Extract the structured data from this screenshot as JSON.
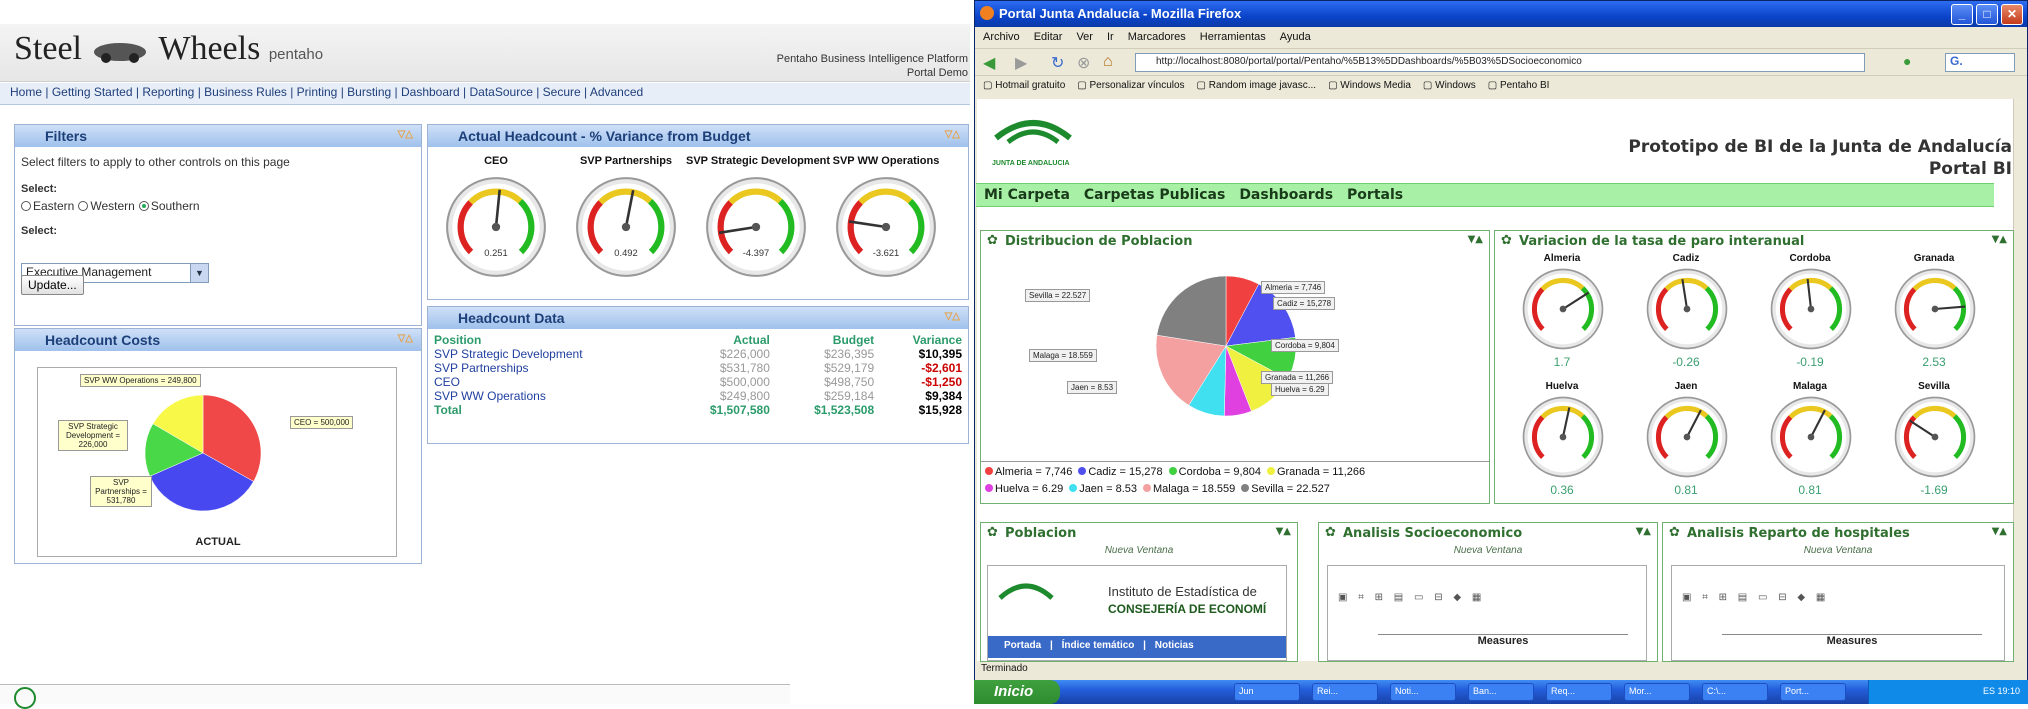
{
  "steelwheels": {
    "logo_text": "Steel",
    "logo_text2": "Wheels",
    "logo_suffix": "pentaho",
    "platform_line1": "Pentaho Business Intelligence Platform",
    "platform_line2": "Portal Demo",
    "nav": [
      "Home",
      "Getting Started",
      "Reporting",
      "Business Rules",
      "Printing",
      "Bursting",
      "Dashboard",
      "DataSource",
      "Secure",
      "Advanced"
    ],
    "filters": {
      "title": "Filters",
      "intro": "Select filters to apply to other controls on this page",
      "select_label1": "Select:",
      "radio_options": [
        "Eastern",
        "Western",
        "Southern"
      ],
      "radio_selected": "Southern",
      "select_label2": "Select:",
      "select_value": "Executive Management",
      "update_button": "Update..."
    },
    "headcount_costs": {
      "title": "Headcount Costs",
      "chart_caption": "ACTUAL",
      "labels": [
        "SVP WW Operations = 249,800",
        "SVP Strategic Development = 226,000",
        "SVP Partnerships = 531,780",
        "CEO = 500,000"
      ]
    },
    "actual_headcount": {
      "title": "Actual Headcount - % Variance from Budget",
      "gauges": [
        {
          "label": "CEO",
          "value": "0.251"
        },
        {
          "label": "SVP Partnerships",
          "value": "0.492"
        },
        {
          "label": "SVP Strategic Development",
          "value": "-4.397"
        },
        {
          "label": "SVP WW Operations",
          "value": "-3.621"
        }
      ]
    },
    "headcount_data": {
      "title": "Headcount Data",
      "headers": [
        "Position",
        "Actual",
        "Budget",
        "Variance"
      ],
      "rows": [
        [
          "SVP Strategic Development",
          "$226,000",
          "$236,395",
          "$10,395"
        ],
        [
          "SVP Partnerships",
          "$531,780",
          "$529,179",
          "-$2,601"
        ],
        [
          "CEO",
          "$500,000",
          "$498,750",
          "-$1,250"
        ],
        [
          "SVP WW Operations",
          "$249,800",
          "$259,184",
          "$9,384"
        ],
        [
          "Total",
          "$1,507,580",
          "$1,523,508",
          "$15,928"
        ]
      ]
    }
  },
  "firefox": {
    "window_title": "Portal Junta Andalucía - Mozilla Firefox",
    "menu": [
      "Archivo",
      "Editar",
      "Ver",
      "Ir",
      "Marcadores",
      "Herramientas",
      "Ayuda"
    ],
    "url": "http://localhost:8080/portal/portal/Pentaho/%5B13%5DDashboards/%5B03%5DSocioeconomico",
    "bookmarks": [
      "Hotmail gratuito",
      "Personalizar vínculos",
      "Random image javasc...",
      "Windows Media",
      "Windows",
      "Pentaho BI"
    ],
    "status": "Terminado",
    "taskbar_start": "Inicio",
    "taskbar_items": [
      "Jun",
      "Rei...",
      "Noti...",
      "Ban...",
      "Req...",
      "Mor...",
      "C:\\...",
      "Port..."
    ],
    "tray": "ES 19:10"
  },
  "portal": {
    "logo_caption": "JUNTA DE ANDALUCIA",
    "title_line1": "Prototipo de BI de la Junta de Andalucía",
    "title_line2": "Portal BI",
    "menu": [
      "Mi Carpeta",
      "Carpetas Publicas",
      "Dashboards",
      "Portals"
    ],
    "distribucion": {
      "title": "Distribucion de Poblacion",
      "legend_row1": [
        "Almeria = 7,746",
        "Cadiz = 15,278",
        "Cordoba = 9,804",
        "Granada = 11,266"
      ],
      "legend_row2": [
        "Huelva = 6.29",
        "Jaen = 8.53",
        "Malaga = 18.559",
        "Sevilla = 22.527"
      ]
    },
    "variacion": {
      "title": "Variacion de la tasa de paro interanual",
      "gauges": [
        {
          "label": "Almeria",
          "value": "1.7"
        },
        {
          "label": "Cadiz",
          "value": "-0.26"
        },
        {
          "label": "Cordoba",
          "value": "-0.19"
        },
        {
          "label": "Granada",
          "value": "2.53"
        },
        {
          "label": "Huelva",
          "value": "0.36"
        },
        {
          "label": "Jaen",
          "value": "0.81"
        },
        {
          "label": "Malaga",
          "value": "0.81"
        },
        {
          "label": "Sevilla",
          "value": "-1.69"
        }
      ]
    },
    "poblacion": {
      "title": "Poblacion",
      "subtitle": "Nueva Ventana",
      "inst_line1": "Instituto de Estadística de",
      "inst_line2": "CONSEJERÍA DE ECONOMÍ",
      "links": [
        "Portada",
        "Índice temático",
        "Noticias"
      ]
    },
    "socio": {
      "title": "Analisis Socioeconomico",
      "subtitle": "Nueva Ventana",
      "measures": "Measures"
    },
    "hospitales": {
      "title": "Analisis Reparto de hospitales",
      "subtitle": "Nueva Ventana",
      "measures": "Measures"
    }
  },
  "chart_data": [
    {
      "type": "pie",
      "title": "",
      "caption": "ACTUAL",
      "categories": [
        "CEO",
        "SVP Partnerships",
        "SVP Strategic Development",
        "SVP WW Operations"
      ],
      "values": [
        500000,
        531780,
        226000,
        249800
      ],
      "colors": [
        "#f04848",
        "#4848f0",
        "#48d848",
        "#f8f848"
      ]
    },
    {
      "type": "pie",
      "title": "Distribucion de Poblacion",
      "categories": [
        "Almeria",
        "Cadiz",
        "Cordoba",
        "Granada",
        "Huelva",
        "Jaen",
        "Malaga",
        "Sevilla"
      ],
      "values": [
        7.746,
        15.278,
        9.804,
        11.266,
        6.29,
        8.53,
        18.559,
        22.527
      ],
      "colors": [
        "#f04040",
        "#5050f0",
        "#40d040",
        "#f0f040",
        "#e040e0",
        "#40e0f0",
        "#f4a0a0",
        "#808080"
      ]
    }
  ]
}
